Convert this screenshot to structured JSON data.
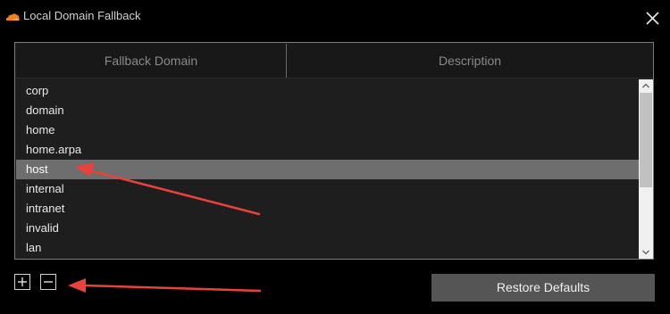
{
  "window": {
    "title": "Local Domain Fallback",
    "app_icon": "cloudflare-cloud-icon",
    "close_icon": "close-icon"
  },
  "table": {
    "columns": [
      "Fallback Domain",
      "Description"
    ],
    "rows": [
      "corp",
      "domain",
      "home",
      "home.arpa",
      "host",
      "internal",
      "intranet",
      "invalid",
      "lan"
    ],
    "selected_row": "host"
  },
  "toolbar": {
    "add_icon": "plus-icon",
    "remove_icon": "minus-icon",
    "restore_label": "Restore Defaults"
  },
  "colors": {
    "background": "#000000",
    "list_background": "#1e1e1e",
    "selection": "#6e6e6e",
    "button": "#555555",
    "icon_orange": "#f38020",
    "annotation_arrow": "#e8423a"
  }
}
